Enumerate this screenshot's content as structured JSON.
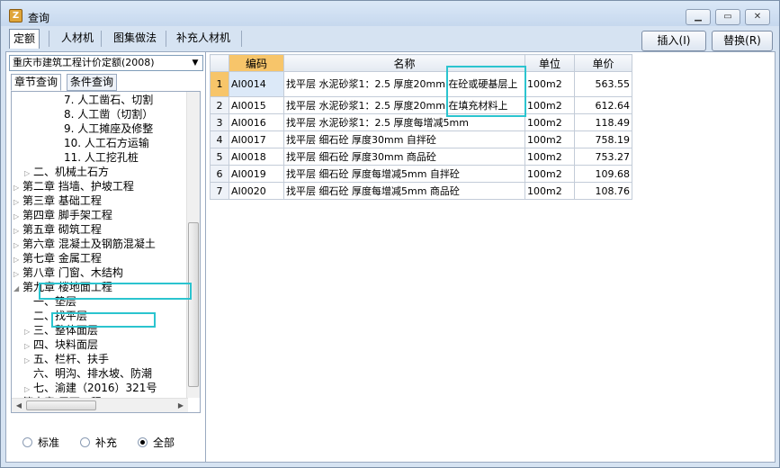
{
  "window": {
    "title": "查询",
    "app_icon": "app-logo-icon",
    "controls": [
      "minimize-icon",
      "maximize-icon",
      "close-icon"
    ]
  },
  "toolbar": {
    "tabs": [
      "定额",
      "人材机",
      "图集做法",
      "补充人材机"
    ],
    "active_tab": "定额",
    "insert_label": "插入(I)",
    "replace_label": "替换(R)"
  },
  "left_panel": {
    "dropdown_value": "重庆市建筑工程计价定额(2008)",
    "tabs": [
      "章节查询",
      "条件查询"
    ],
    "active_tab": "章节查询",
    "tree": [
      {
        "label": "7. 人工凿石、切割",
        "expander": ""
      },
      {
        "label": "8. 人工凿（切割）",
        "expander": ""
      },
      {
        "label": "9. 人工摊座及修整",
        "expander": ""
      },
      {
        "label": "10. 人工石方运输",
        "expander": ""
      },
      {
        "label": "11. 人工挖孔桩",
        "expander": ""
      },
      {
        "label": "二、机械土石方",
        "expander": "▷"
      },
      {
        "label": "第二章 挡墙、护坡工程",
        "expander": "▷"
      },
      {
        "label": "第三章 基础工程",
        "expander": "▷"
      },
      {
        "label": "第四章 脚手架工程",
        "expander": "▷"
      },
      {
        "label": "第五章 砌筑工程",
        "expander": "▷"
      },
      {
        "label": "第六章 混凝土及钢筋混凝土",
        "expander": "▷"
      },
      {
        "label": "第七章 金属工程",
        "expander": "▷"
      },
      {
        "label": "第八章 门窗、木结构",
        "expander": "▷"
      },
      {
        "label": "第九章 楼地面工程",
        "expander": "◢"
      },
      {
        "label": "一、垫层",
        "expander": ""
      },
      {
        "label": "二、找平层",
        "expander": ""
      },
      {
        "label": "三、整体面层",
        "expander": "▷"
      },
      {
        "label": "四、块料面层",
        "expander": "▷"
      },
      {
        "label": "五、栏杆、扶手",
        "expander": "▷"
      },
      {
        "label": "六、明沟、排水坡、防潮",
        "expander": ""
      },
      {
        "label": "七、渝建（2016）321号",
        "expander": "▷"
      },
      {
        "label": "第十章 屋面工程",
        "expander": "▷"
      }
    ],
    "radio_options": [
      "标准",
      "补充",
      "全部"
    ],
    "radio_selected": "全部"
  },
  "grid": {
    "columns": [
      "编码",
      "名称",
      "单位",
      "单价"
    ],
    "rows": [
      {
        "n": "1",
        "code": "AI0014",
        "name": "找平层 水泥砂浆1：2.5 厚度20mm 在砼或硬基层上",
        "unit": "100m2",
        "price": "563.55"
      },
      {
        "n": "2",
        "code": "AI0015",
        "name": "找平层 水泥砂浆1：2.5 厚度20mm 在填充材料上",
        "unit": "100m2",
        "price": "612.64"
      },
      {
        "n": "3",
        "code": "AI0016",
        "name": "找平层 水泥砂浆1：2.5 厚度每增减5mm",
        "unit": "100m2",
        "price": "118.49"
      },
      {
        "n": "4",
        "code": "AI0017",
        "name": "找平层 细石砼 厚度30mm 自拌砼",
        "unit": "100m2",
        "price": "758.19"
      },
      {
        "n": "5",
        "code": "AI0018",
        "name": "找平层 细石砼 厚度30mm 商品砼",
        "unit": "100m2",
        "price": "753.27"
      },
      {
        "n": "6",
        "code": "AI0019",
        "name": "找平层 细石砼 厚度每增减5mm 自拌砼",
        "unit": "100m2",
        "price": "109.68"
      },
      {
        "n": "7",
        "code": "AI0020",
        "name": "找平层 细石砼 厚度每增减5mm 商品砼",
        "unit": "100m2",
        "price": "108.76"
      }
    ]
  },
  "colors": {
    "highlight": "#2bc4cf",
    "selected_header": "#f7c56a"
  }
}
